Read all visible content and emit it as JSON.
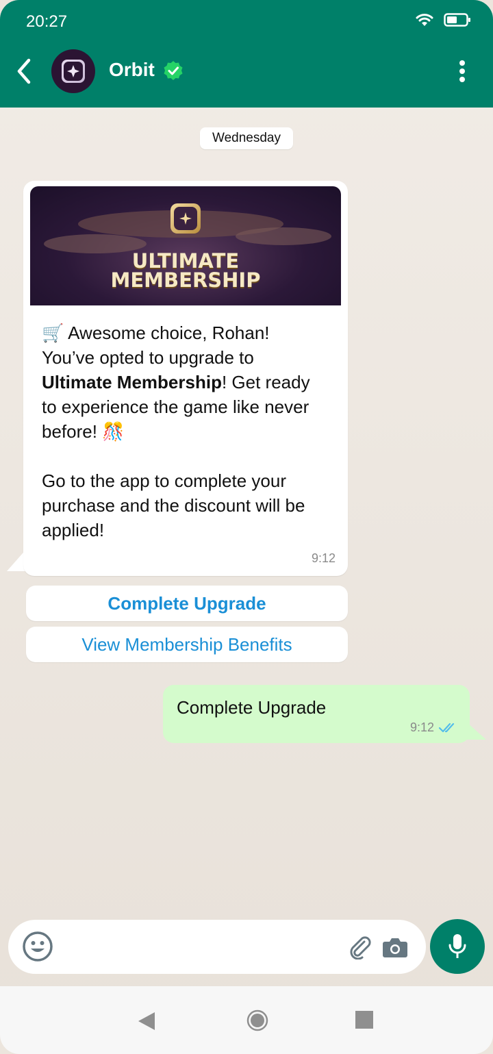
{
  "status_bar": {
    "time": "20:27"
  },
  "header": {
    "title": "Orbit"
  },
  "chat": {
    "day_label": "Wednesday",
    "incoming": {
      "banner_title_line1": "ULTIMATE",
      "banner_title_line2": "MEMBERSHIP",
      "emoji_cart": "🛒",
      "line1": "Awesome choice, Rohan!",
      "line2": "You’ve opted to upgrade to",
      "bold": "Ultimate Membership",
      "line3_after_bold": "! Get ready",
      "line4": "to experience the game like never",
      "line5": "before! ",
      "emoji_party": "🎊",
      "para2_line1": "Go to the app to complete your",
      "para2_line2": "purchase and the discount will be",
      "para2_line3": "applied!",
      "time": "9:12"
    },
    "cta_buttons": [
      {
        "label": "Complete Upgrade"
      },
      {
        "label": "View Membership Benefits"
      }
    ],
    "outgoing": {
      "text": "Complete Upgrade",
      "time": "9:12"
    }
  },
  "input": {
    "placeholder": ""
  },
  "colors": {
    "header": "#008069",
    "outgoing_bubble": "#d4fbcc",
    "cta_text": "#1a8fd6",
    "verified_badge": "#25d366",
    "read_ticks": "#53bdeb"
  },
  "icons": {
    "back": "back-arrow-icon",
    "verified": "verified-badge-icon",
    "menu": "more-vertical-icon",
    "emoji": "emoji-icon",
    "attach": "paperclip-icon",
    "camera": "camera-icon",
    "mic": "microphone-icon",
    "wifi": "wifi-icon",
    "battery": "battery-icon"
  }
}
